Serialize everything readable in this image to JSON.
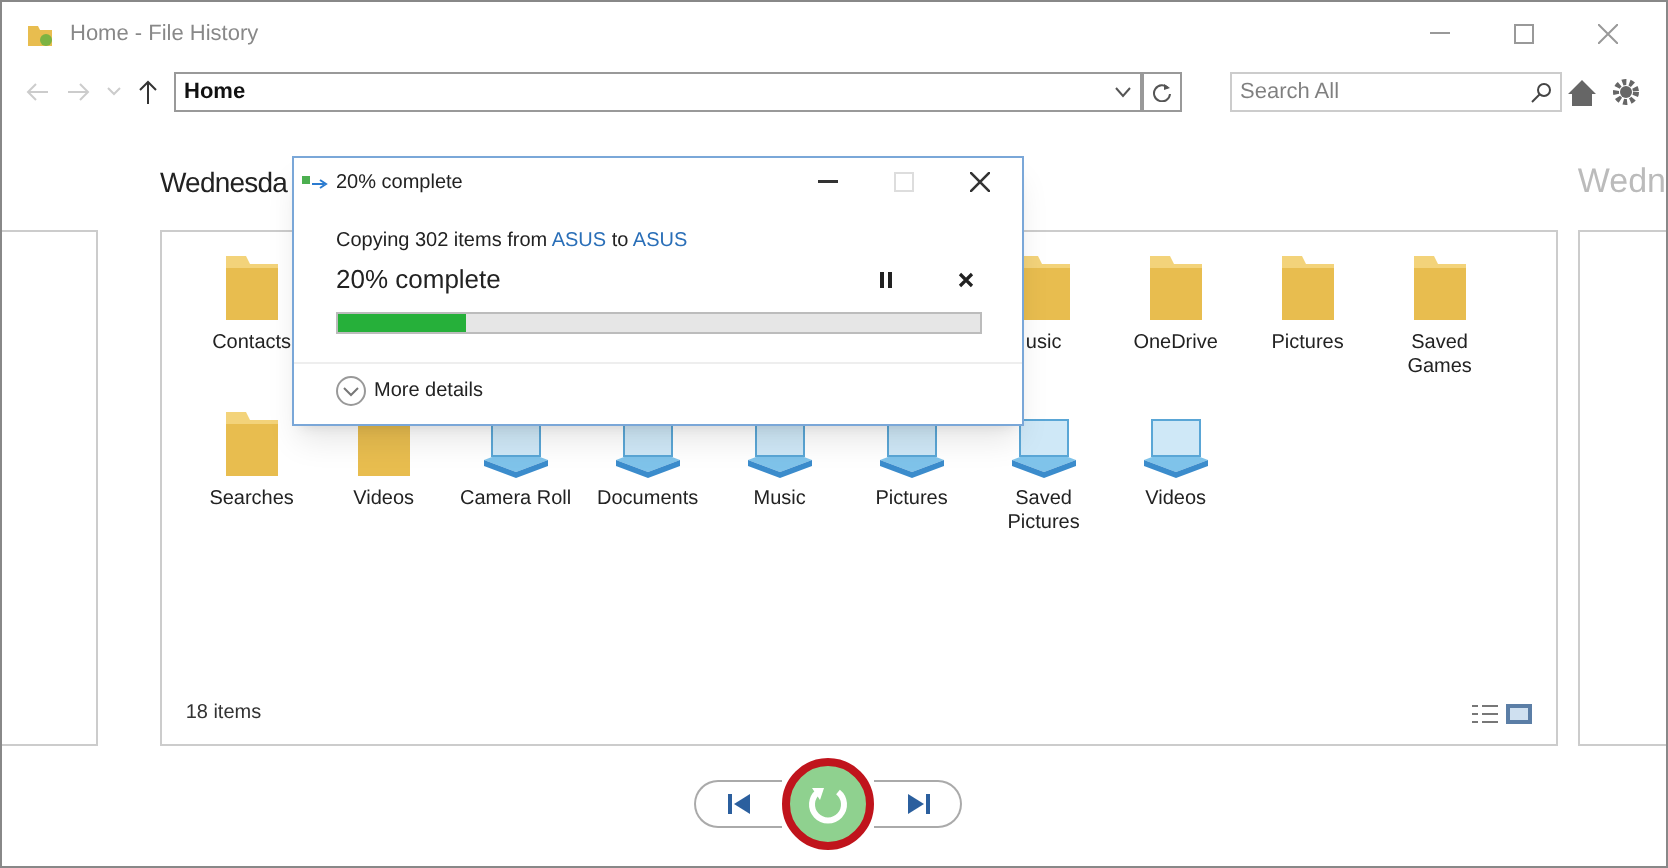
{
  "window": {
    "title": "Home - File History"
  },
  "address": {
    "value": "Home"
  },
  "search": {
    "placeholder": "Search All"
  },
  "heading": "Wednesda",
  "next_heading": "Wedn",
  "rows": [
    [
      {
        "label": "Contacts",
        "kind": "folder"
      },
      {
        "label": "usic",
        "kind": "folder"
      },
      {
        "label": "OneDrive",
        "kind": "folder"
      },
      {
        "label": "Pictures",
        "kind": "folder"
      },
      {
        "label": "Saved Games",
        "kind": "folder"
      }
    ],
    [
      {
        "label": "Searches",
        "kind": "folder"
      },
      {
        "label": "Videos",
        "kind": "folder"
      },
      {
        "label": "Camera Roll",
        "kind": "library"
      },
      {
        "label": "Documents",
        "kind": "library"
      },
      {
        "label": "Music",
        "kind": "library"
      },
      {
        "label": "Pictures",
        "kind": "library"
      },
      {
        "label": "Saved Pictures",
        "kind": "library"
      },
      {
        "label": "Videos",
        "kind": "library"
      }
    ]
  ],
  "status": "18 items",
  "dialog": {
    "title": "20% complete",
    "source": "ASUS",
    "destination": "ASUS",
    "prefix": "Copying 302 items from",
    "joiner": "to",
    "progress_text": "20% complete",
    "level": 0.2,
    "details": "More details"
  },
  "restore": {
    "highlighted": true
  }
}
